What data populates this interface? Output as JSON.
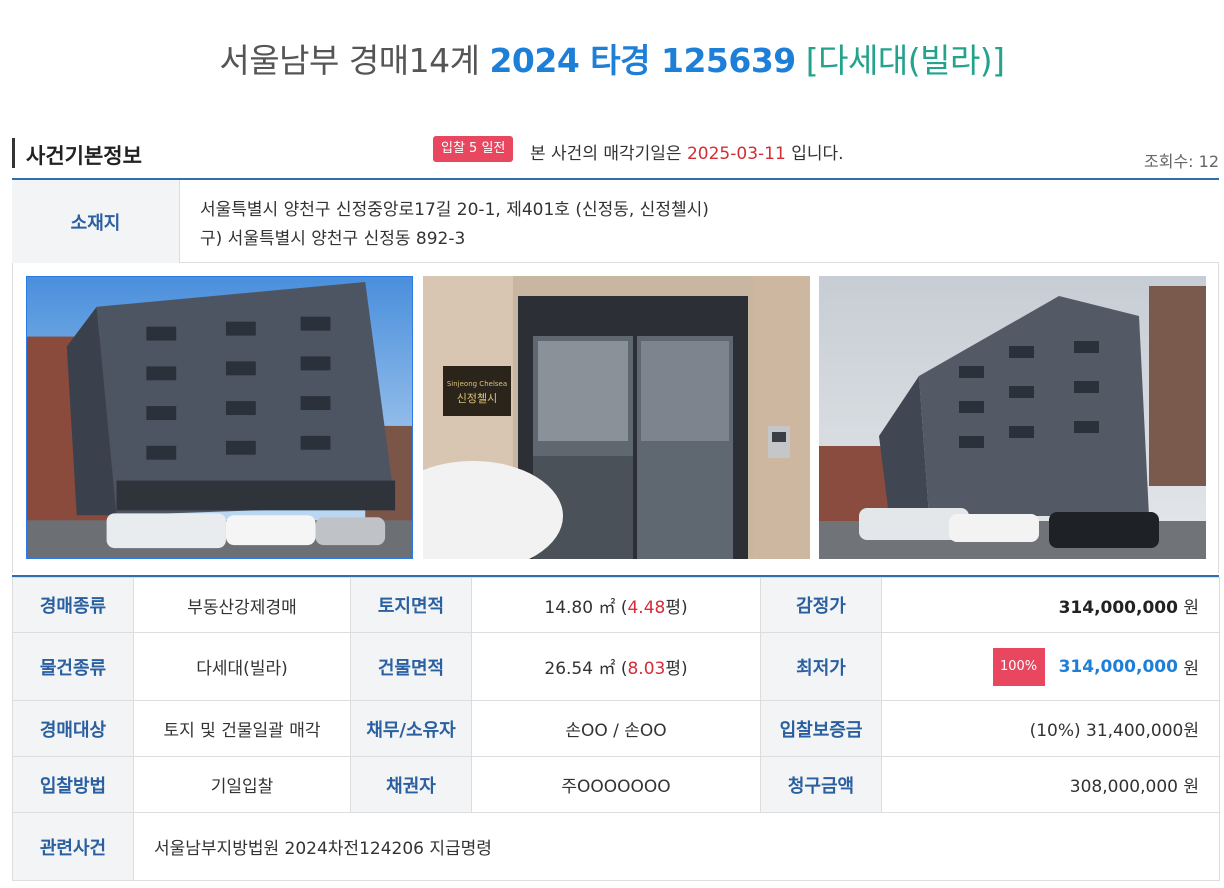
{
  "title": {
    "court": "서울남부 경매14계",
    "case_number": "2024 타경 125639",
    "property_type": "[다세대(빌라)]"
  },
  "section": {
    "title": "사건기본정보",
    "badge": "입찰 5 일전",
    "notice_prefix": "본 사건의 매각기일은",
    "notice_date": "2025-03-11",
    "notice_suffix": "입니다.",
    "views": "조회수: 12"
  },
  "location": {
    "label": "소재지",
    "address": "서울특별시 양천구 신정중앙로17길 20-1, 제401호 (신정동, 신정첼시)",
    "old_address": "구) 서울특별시 양천구 신정동 892-3"
  },
  "photos": [
    {
      "name": "building-exterior-front"
    },
    {
      "name": "building-entrance"
    },
    {
      "name": "building-exterior-side"
    }
  ],
  "entrance_sign": {
    "line1": "Sinjeong Chelsea",
    "line2": "신정첼시"
  },
  "info": {
    "auction_type_label": "경매종류",
    "auction_type": "부동산강제경매",
    "land_area_label": "토지면적",
    "land_area_m2": "14.80 ㎡ (",
    "land_area_pyeong": "4.48",
    "land_area_unit": "평)",
    "appraisal_label": "감정가",
    "appraisal_value": "314,000,000",
    "won": "원",
    "item_type_label": "물건종류",
    "item_type": "다세대(빌라)",
    "building_area_label": "건물면적",
    "building_area_m2": "26.54 ㎡ (",
    "building_area_pyeong": "8.03",
    "building_area_unit": "평)",
    "min_price_label": "최저가",
    "min_price_pct": "100%",
    "min_price_value": "314,000,000",
    "target_label": "경매대상",
    "target": "토지 및 건물일괄 매각",
    "debtor_label": "채무/소유자",
    "debtor": "손OO / 손OO",
    "deposit_label": "입찰보증금",
    "deposit": "(10%) 31,400,000원",
    "bid_method_label": "입찰방법",
    "bid_method": "기일입찰",
    "creditor_label": "채권자",
    "creditor": "주OOOOOOO",
    "claim_label": "청구금액",
    "claim": "308,000,000 원",
    "related_label": "관련사건",
    "related": "서울남부지방법원 2024차전124206 지급명령"
  },
  "colors": {
    "accent_blue": "#1e7fd8",
    "label_blue": "#2a5fa0",
    "teal": "#23a28c",
    "badge_red": "#e8475f",
    "date_red": "#d52c36"
  }
}
